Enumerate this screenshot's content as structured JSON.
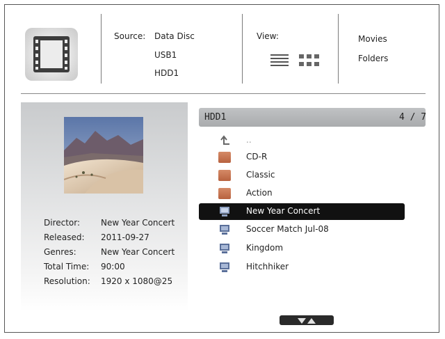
{
  "source": {
    "label": "Source:",
    "options": [
      "Data Disc",
      "USB1",
      "HDD1"
    ]
  },
  "view": {
    "label": "View:",
    "modes": [
      "list-view-icon",
      "grid-view-icon"
    ]
  },
  "categories": [
    "Movies",
    "Folders"
  ],
  "info": {
    "labels": [
      "Director:",
      "Released:",
      "Genres:",
      "Total Time:",
      "Resolution:"
    ],
    "values": [
      "New Year Concert",
      "2011-09-27",
      "New Year Concert",
      "90:00",
      "1920 x 1080@25"
    ]
  },
  "list": {
    "path": "HDD1",
    "count": "4 / 7",
    "parent_label": "..",
    "items": [
      {
        "label": "CD-R",
        "icon": "folder-icon"
      },
      {
        "label": "Classic",
        "icon": "folder-icon"
      },
      {
        "label": "Action",
        "icon": "folder-icon"
      },
      {
        "label": "New Year Concert",
        "icon": "movie-file-icon",
        "selected": true
      },
      {
        "label": "Soccer Match Jul-08",
        "icon": "movie-file-icon"
      },
      {
        "label": "Kingdom",
        "icon": "movie-file-icon"
      },
      {
        "label": "Hitchhiker",
        "icon": "movie-file-icon"
      }
    ]
  },
  "colors": {
    "selected_row": "#111111",
    "folder": "#c5714f",
    "panel": "#d6d7d8"
  }
}
